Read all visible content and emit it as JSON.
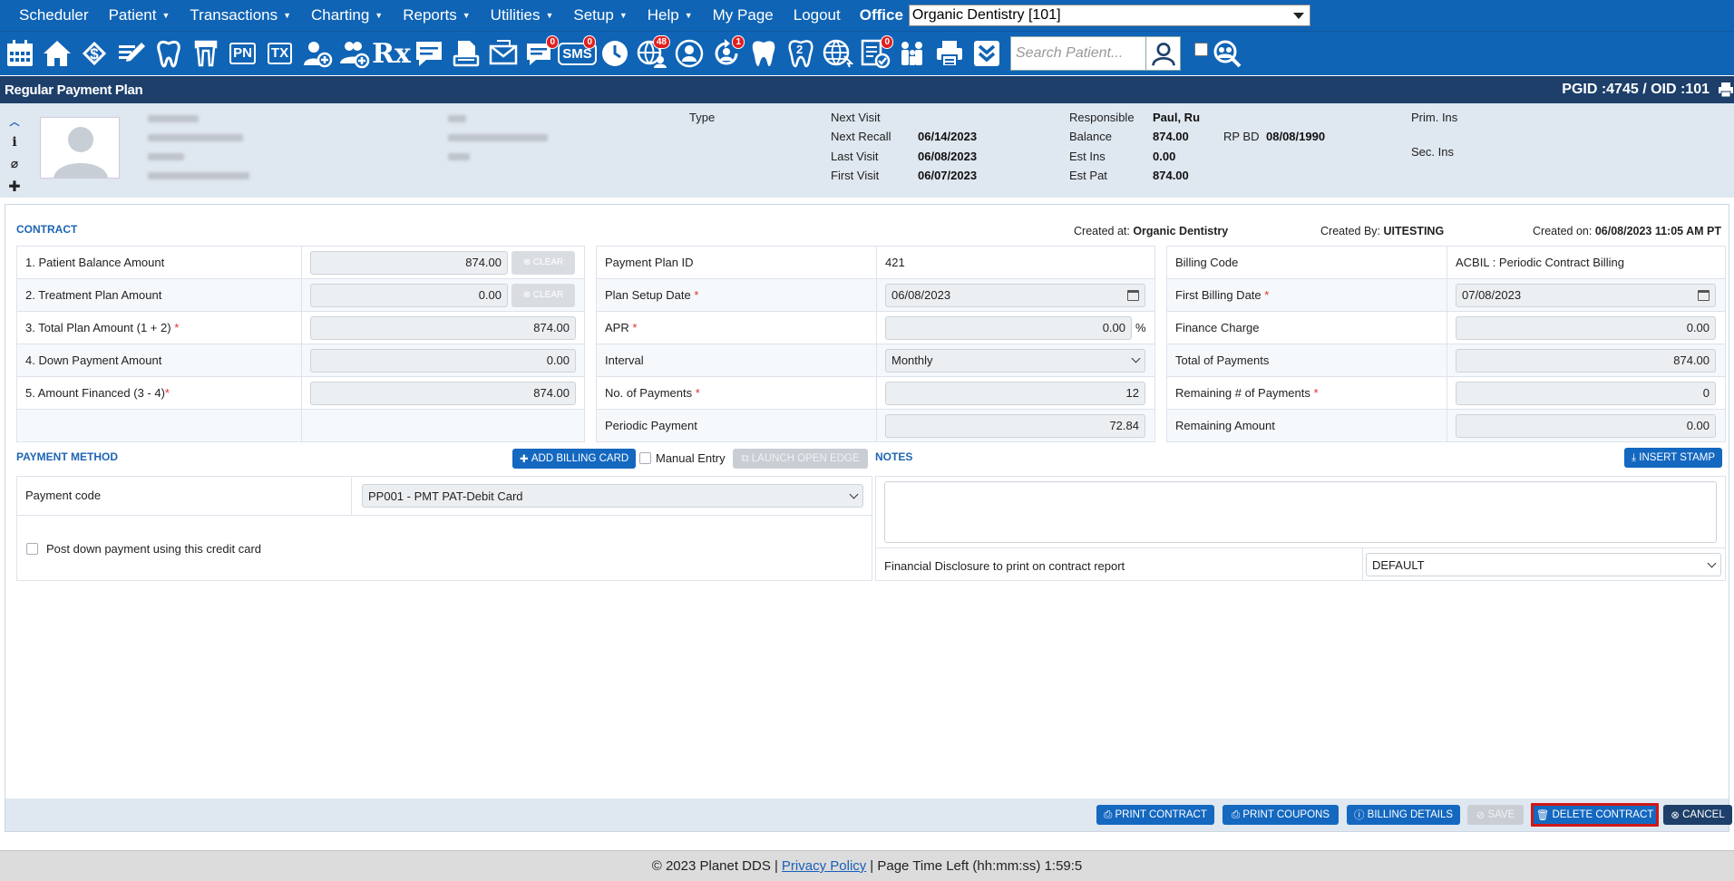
{
  "menu": {
    "items": [
      {
        "label": "Scheduler",
        "caret": false
      },
      {
        "label": "Patient",
        "caret": true
      },
      {
        "label": "Transactions",
        "caret": true
      },
      {
        "label": "Charting",
        "caret": true
      },
      {
        "label": "Reports",
        "caret": true
      },
      {
        "label": "Utilities",
        "caret": true
      },
      {
        "label": "Setup",
        "caret": true
      },
      {
        "label": "Help",
        "caret": true
      },
      {
        "label": "My Page",
        "caret": false
      },
      {
        "label": "Logout",
        "caret": false
      }
    ],
    "office_label": "Office",
    "office_value": "Organic Dentistry [101]"
  },
  "toolbar": {
    "pn": "PN",
    "tx": "TX",
    "rx": "Rx",
    "sms": "SMS",
    "badge_messages": "0",
    "badge_sms": "0",
    "badge_web": "48",
    "badge_recall": "1",
    "badge_forms": "0",
    "tooth2": "2",
    "search_placeholder": "Search Patient..."
  },
  "title": {
    "text": "Regular Payment Plan",
    "ids": "PGID :4745  /  OID :101"
  },
  "patient": {
    "type_label": "Type",
    "next_visit_label": "Next Visit",
    "next_recall_label": "Next Recall",
    "next_recall": "06/14/2023",
    "last_visit_label": "Last Visit",
    "last_visit": "06/08/2023",
    "first_visit_label": "First Visit",
    "first_visit": "06/07/2023",
    "responsible_label": "Responsible",
    "responsible": "Paul, Ru",
    "balance_label": "Balance",
    "balance": "874.00",
    "rp_bd_label": "RP BD",
    "rp_bd": "08/08/1990",
    "est_ins_label": "Est Ins",
    "est_ins": "0.00",
    "est_pat_label": "Est Pat",
    "est_pat": "874.00",
    "prim_ins_label": "Prim. Ins",
    "sec_ins_label": "Sec. Ins"
  },
  "contract": {
    "title": "CONTRACT",
    "created_at_label": "Created at:",
    "created_at": "Organic Dentistry",
    "created_by_label": "Created By:",
    "created_by": "UITESTING",
    "created_on_label": "Created on:",
    "created_on": "06/08/2023 11:05 AM PT",
    "clear_label": "CLEAR",
    "left": [
      {
        "label": "1.  Patient Balance Amount",
        "value": "874.00",
        "req": ""
      },
      {
        "label": "2. Treatment Plan Amount",
        "value": "0.00",
        "req": ""
      },
      {
        "label": "3. Total Plan Amount (1 + 2)",
        "value": "874.00",
        "req": "*"
      },
      {
        "label": "4. Down Payment Amount",
        "value": "0.00",
        "req": ""
      },
      {
        "label": "5. Amount Financed (3 - 4)",
        "value": "874.00",
        "req": "*"
      }
    ],
    "mid": {
      "plan_id_label": "Payment Plan ID",
      "plan_id": "421",
      "setup_date_label": "Plan Setup Date",
      "setup_date": "06/08/2023",
      "apr_label": "APR",
      "apr": "0.00",
      "apr_unit": "%",
      "interval_label": "Interval",
      "interval": "Monthly",
      "num_payments_label": "No. of Payments",
      "num_payments": "12",
      "periodic_label": "Periodic Payment",
      "periodic": "72.84"
    },
    "right": {
      "billing_code_label": "Billing Code",
      "billing_code": "ACBIL : Periodic Contract Billing",
      "first_billing_label": "First Billing Date",
      "first_billing": "07/08/2023",
      "finance_label": "Finance Charge",
      "finance": "0.00",
      "total_payments_label": "Total of Payments",
      "total_payments": "874.00",
      "remaining_num_label": "Remaining # of Payments",
      "remaining_num": "0",
      "remaining_amt_label": "Remaining Amount",
      "remaining_amt": "0.00"
    }
  },
  "payment_method": {
    "title": "PAYMENT METHOD",
    "add_card": "ADD BILLING CARD",
    "manual_entry": "Manual Entry",
    "launch_edge": "LAUNCH OPEN EDGE",
    "code_label": "Payment code",
    "code_value": "PP001 - PMT PAT-Debit Card",
    "post_down": "Post down payment using this credit card"
  },
  "notes": {
    "title": "NOTES",
    "insert_stamp": "INSERT STAMP",
    "disclosure_label": "Financial Disclosure to print on contract report",
    "disclosure_value": "DEFAULT"
  },
  "actions": {
    "print_contract": "PRINT CONTRACT",
    "print_coupons": "PRINT COUPONS",
    "billing_details": "BILLING DETAILS",
    "save": "SAVE",
    "delete": "DELETE CONTRACT",
    "cancel": "CANCEL"
  },
  "footer": {
    "copyright": "© 2023 Planet DDS |",
    "privacy": "Privacy Policy",
    "time_left": "|  Page Time Left (hh:mm:ss) 1:59:5"
  }
}
